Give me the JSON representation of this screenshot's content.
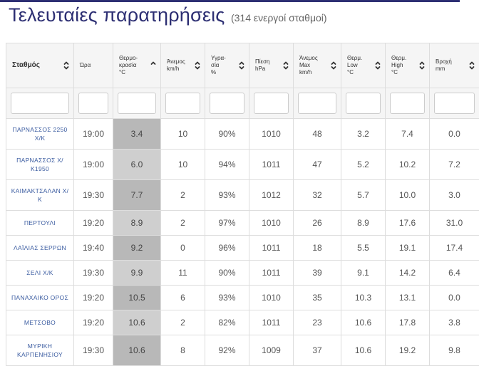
{
  "header": {
    "title": "Τελευταίες παρατηρήσεις",
    "subtitle": "(314 ενεργοί σταθμοί)"
  },
  "table": {
    "columns": [
      {
        "label": "Σταθμός",
        "sort": "both"
      },
      {
        "label": "Ώρα",
        "sort": "none"
      },
      {
        "label": "Θερμο-\nκρασία\n°C",
        "sort": "up"
      },
      {
        "label": "Άνεμος\nkm/h",
        "sort": "both"
      },
      {
        "label": "Υγρα-\nσία\n%",
        "sort": "both"
      },
      {
        "label": "Πίεση\nhPa",
        "sort": "both"
      },
      {
        "label": "Άνεμος\nMax\nkm/h",
        "sort": "both"
      },
      {
        "label": "Θερμ.\nLow\n°C",
        "sort": "both"
      },
      {
        "label": "Θερμ.\nHigh\n°C",
        "sort": "both"
      },
      {
        "label": "Βροχή\nmm",
        "sort": "both"
      }
    ],
    "rows": [
      [
        "ΠΑΡΝΑΣΣΟΣ 2250 Χ/Κ",
        "19:00",
        "3.4",
        "10",
        "90%",
        "1010",
        "48",
        "3.2",
        "7.4",
        "0.0"
      ],
      [
        "ΠΑΡΝΑΣΣΟΣ Χ/Κ1950",
        "19:00",
        "6.0",
        "10",
        "94%",
        "1011",
        "47",
        "5.2",
        "10.2",
        "7.2"
      ],
      [
        "ΚΑΙΜΑΚΤΣΑΛΑΝ Χ/Κ",
        "19:30",
        "7.7",
        "2",
        "93%",
        "1012",
        "32",
        "5.7",
        "10.0",
        "3.0"
      ],
      [
        "ΠΕΡΤΟΥΛΙ",
        "19:20",
        "8.9",
        "2",
        "97%",
        "1010",
        "26",
        "8.9",
        "17.6",
        "31.0"
      ],
      [
        "ΛΑΪΛΙΑΣ ΣΕΡΡΩΝ",
        "19:40",
        "9.2",
        "0",
        "96%",
        "1011",
        "18",
        "5.5",
        "19.1",
        "17.4"
      ],
      [
        "ΣΕΛΙ Χ/Κ",
        "19:30",
        "9.9",
        "11",
        "90%",
        "1011",
        "39",
        "9.1",
        "14.2",
        "6.4"
      ],
      [
        "ΠΑΝΑΧΑΙΚΟ ΟΡΟΣ",
        "19:20",
        "10.5",
        "6",
        "93%",
        "1010",
        "35",
        "10.3",
        "13.1",
        "0.0"
      ],
      [
        "ΜΕΤΣΟΒΟ",
        "19:20",
        "10.6",
        "2",
        "82%",
        "1011",
        "23",
        "10.6",
        "17.8",
        "3.8"
      ],
      [
        "ΜΥΡΙΚΗ ΚΑΡΠΕΝΗΣΙΟΥ",
        "19:30",
        "10.6",
        "8",
        "92%",
        "1009",
        "37",
        "10.6",
        "19.2",
        "9.8"
      ]
    ],
    "temp_shades": [
      "#b8b8b8",
      "#cfcfcf",
      "#b8b8b8",
      "#cfcfcf",
      "#b8b8b8",
      "#cfcfcf",
      "#b8b8b8",
      "#cfcfcf",
      "#b8b8b8"
    ]
  }
}
